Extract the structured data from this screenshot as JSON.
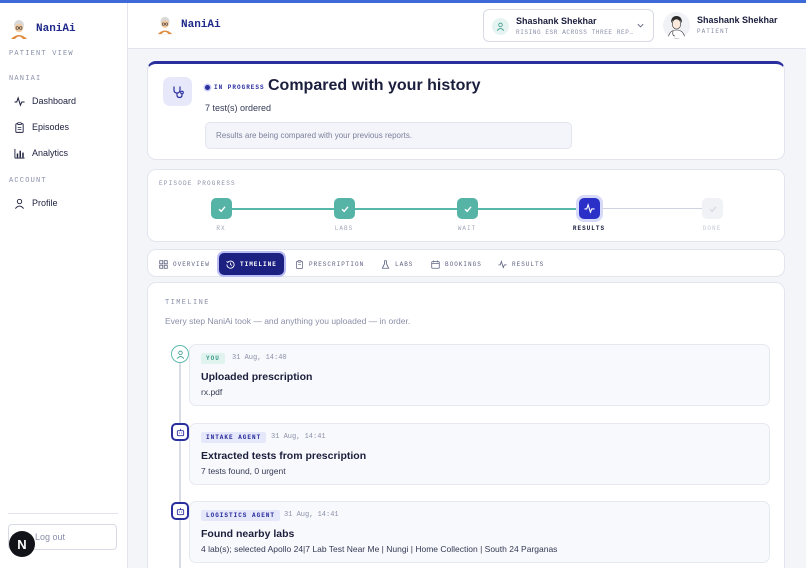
{
  "app": {
    "brand": "NaniAi",
    "view_label": "PATIENT VIEW"
  },
  "sidebar": {
    "sections": [
      {
        "label": "NANIAI"
      },
      {
        "label": "ACCOUNT"
      }
    ],
    "items": [
      {
        "label": "Dashboard",
        "icon": "activity-icon"
      },
      {
        "label": "Episodes",
        "icon": "clipboard-icon"
      },
      {
        "label": "Analytics",
        "icon": "bar-chart-icon"
      },
      {
        "label": "Profile",
        "icon": "user-icon"
      }
    ],
    "logout_label": "Log out",
    "n_badge": "N"
  },
  "header": {
    "brand": "NaniAi",
    "profile_switch": {
      "name": "Shashank Shekhar",
      "subtitle": "RISING ESR ACROSS THREE REP..."
    },
    "user": {
      "name": "Shashank Shekhar",
      "role": "PATIENT"
    }
  },
  "episode": {
    "status": "IN PROGRESS",
    "title": "Compared with your history",
    "tests_ordered": "7 test(s) ordered",
    "note": "Results are being compared with your previous reports."
  },
  "progress": {
    "label": "EPISODE PROGRESS",
    "steps": [
      {
        "label": "RX",
        "state": "done"
      },
      {
        "label": "LABS",
        "state": "done"
      },
      {
        "label": "WAIT",
        "state": "done"
      },
      {
        "label": "RESULTS",
        "state": "current"
      },
      {
        "label": "DONE",
        "state": "future"
      }
    ]
  },
  "tabs": [
    {
      "label": "OVERVIEW",
      "icon": "grid-icon"
    },
    {
      "label": "TIMELINE",
      "icon": "history-icon",
      "active": true
    },
    {
      "label": "PRESCRIPTION",
      "icon": "clipboard-icon"
    },
    {
      "label": "LABS",
      "icon": "flask-icon"
    },
    {
      "label": "BOOKINGS",
      "icon": "calendar-icon"
    },
    {
      "label": "RESULTS",
      "icon": "activity-icon"
    }
  ],
  "timeline": {
    "heading": "TIMELINE",
    "subtitle": "Every step NaniAi took — and anything you uploaded — in order.",
    "events": [
      {
        "actor": "YOU",
        "actor_type": "user",
        "time": "31 Aug, 14:40",
        "title": "Uploaded prescription",
        "detail": "rx.pdf"
      },
      {
        "actor": "INTAKE AGENT",
        "actor_type": "agent",
        "time": "31 Aug, 14:41",
        "title": "Extracted tests from prescription",
        "detail": "7 tests found, 0 urgent"
      },
      {
        "actor": "LOGISTICS AGENT",
        "actor_type": "agent",
        "time": "31 Aug, 14:41",
        "title": "Found nearby labs",
        "detail": "4 lab(s); selected Apollo 24|7 Lab Test Near Me | Nungi | Home Collection | South 24 Parganas"
      }
    ]
  },
  "colors": {
    "accent": "#2a2f9e",
    "teal": "#56b4a7",
    "active_tab": "#1c2080"
  }
}
